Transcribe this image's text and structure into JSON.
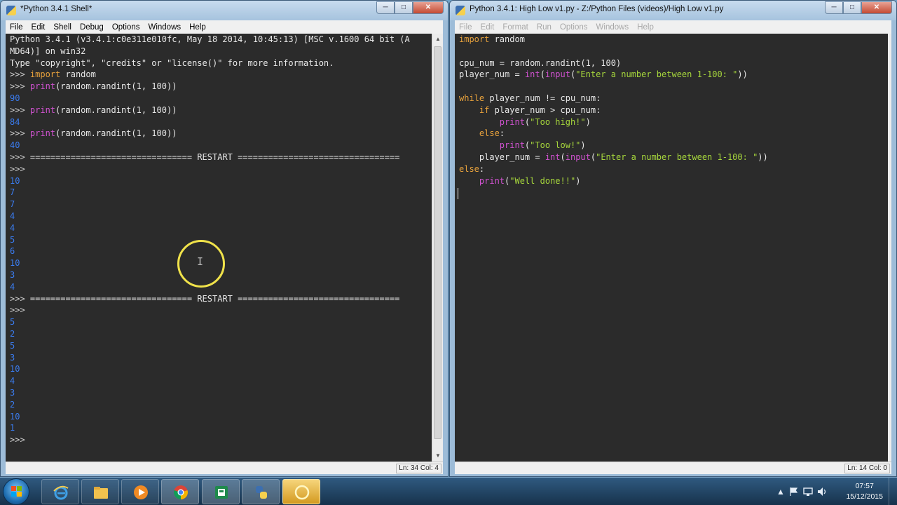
{
  "colors": {
    "code_background": "#2b2b2b",
    "code_text": "#e8e8e8",
    "keyword": "#e8a23c",
    "builtin": "#d052d0",
    "string": "#a6d63c",
    "shell_output": "#3a7cf0",
    "cursor_highlight": "#f0e24a"
  },
  "shell": {
    "title": "*Python 3.4.1 Shell*",
    "menu": [
      "File",
      "Edit",
      "Shell",
      "Debug",
      "Options",
      "Windows",
      "Help"
    ],
    "lines": [
      [
        {
          "t": "Python 3.4.1 (v3.4.1:c0e311e010fc, May 18 2014, 10:45:13) [MSC v.1600 64 bit (A",
          "c": "text"
        }
      ],
      [
        {
          "t": "MD64)] on win32",
          "c": "text"
        }
      ],
      [
        {
          "t": "Type \"copyright\", \"credits\" or \"license()\" for more information.",
          "c": "text"
        }
      ],
      [
        {
          "t": ">>> ",
          "c": "prompt"
        },
        {
          "t": "import",
          "c": "kw"
        },
        {
          "t": " random",
          "c": "text"
        }
      ],
      [
        {
          "t": ">>> ",
          "c": "prompt"
        },
        {
          "t": "print",
          "c": "builtin"
        },
        {
          "t": "(random.randint(1, 100))",
          "c": "text"
        }
      ],
      [
        {
          "t": "90",
          "c": "out"
        }
      ],
      [
        {
          "t": ">>> ",
          "c": "prompt"
        },
        {
          "t": "print",
          "c": "builtin"
        },
        {
          "t": "(random.randint(1, 100))",
          "c": "text"
        }
      ],
      [
        {
          "t": "84",
          "c": "out"
        }
      ],
      [
        {
          "t": ">>> ",
          "c": "prompt"
        },
        {
          "t": "print",
          "c": "builtin"
        },
        {
          "t": "(random.randint(1, 100))",
          "c": "text"
        }
      ],
      [
        {
          "t": "40",
          "c": "out"
        }
      ],
      [
        {
          "t": ">>> ",
          "c": "prompt"
        },
        {
          "t": "================================ RESTART ================================",
          "c": "text"
        }
      ],
      [
        {
          "t": ">>> ",
          "c": "prompt"
        }
      ],
      [
        {
          "t": "10",
          "c": "out"
        }
      ],
      [
        {
          "t": "7",
          "c": "out"
        }
      ],
      [
        {
          "t": "7",
          "c": "out"
        }
      ],
      [
        {
          "t": "4",
          "c": "out"
        }
      ],
      [
        {
          "t": "4",
          "c": "out"
        }
      ],
      [
        {
          "t": "5",
          "c": "out"
        }
      ],
      [
        {
          "t": "6",
          "c": "out"
        }
      ],
      [
        {
          "t": "10",
          "c": "out"
        }
      ],
      [
        {
          "t": "3",
          "c": "out"
        }
      ],
      [
        {
          "t": "4",
          "c": "out"
        }
      ],
      [
        {
          "t": ">>> ",
          "c": "prompt"
        },
        {
          "t": "================================ RESTART ================================",
          "c": "text"
        }
      ],
      [
        {
          "t": ">>> ",
          "c": "prompt"
        }
      ],
      [
        {
          "t": "5",
          "c": "out"
        }
      ],
      [
        {
          "t": "2",
          "c": "out"
        }
      ],
      [
        {
          "t": "5",
          "c": "out"
        }
      ],
      [
        {
          "t": "3",
          "c": "out"
        }
      ],
      [
        {
          "t": "10",
          "c": "out"
        }
      ],
      [
        {
          "t": "4",
          "c": "out"
        }
      ],
      [
        {
          "t": "3",
          "c": "out"
        }
      ],
      [
        {
          "t": "2",
          "c": "out"
        }
      ],
      [
        {
          "t": "10",
          "c": "out"
        }
      ],
      [
        {
          "t": "1",
          "c": "out"
        }
      ],
      [
        {
          "t": ">>> ",
          "c": "prompt"
        }
      ]
    ],
    "status": "Ln: 34 Col: 4"
  },
  "editor": {
    "title": "Python 3.4.1: High Low v1.py - Z:/Python Files (videos)/High Low v1.py",
    "menu": [
      "File",
      "Edit",
      "Format",
      "Run",
      "Options",
      "Windows",
      "Help"
    ],
    "lines": [
      [
        {
          "t": "import",
          "c": "kw"
        },
        {
          "t": " random",
          "c": "text"
        }
      ],
      [],
      [
        {
          "t": "cpu_num = random.randint(1, 100)",
          "c": "text"
        }
      ],
      [
        {
          "t": "player_num = ",
          "c": "text"
        },
        {
          "t": "int",
          "c": "builtin"
        },
        {
          "t": "(",
          "c": "text"
        },
        {
          "t": "input",
          "c": "builtin"
        },
        {
          "t": "(",
          "c": "text"
        },
        {
          "t": "\"Enter a number between 1-100: \"",
          "c": "str"
        },
        {
          "t": "))",
          "c": "text"
        }
      ],
      [],
      [
        {
          "t": "while",
          "c": "kw"
        },
        {
          "t": " player_num != cpu_num:",
          "c": "text"
        }
      ],
      [
        {
          "t": "    ",
          "c": "text"
        },
        {
          "t": "if",
          "c": "kw"
        },
        {
          "t": " player_num > cpu_num:",
          "c": "text"
        }
      ],
      [
        {
          "t": "        ",
          "c": "text"
        },
        {
          "t": "print",
          "c": "builtin"
        },
        {
          "t": "(",
          "c": "text"
        },
        {
          "t": "\"Too high!\"",
          "c": "str"
        },
        {
          "t": ")",
          "c": "text"
        }
      ],
      [
        {
          "t": "    ",
          "c": "text"
        },
        {
          "t": "else",
          "c": "kw"
        },
        {
          "t": ":",
          "c": "text"
        }
      ],
      [
        {
          "t": "        ",
          "c": "text"
        },
        {
          "t": "print",
          "c": "builtin"
        },
        {
          "t": "(",
          "c": "text"
        },
        {
          "t": "\"Too low!\"",
          "c": "str"
        },
        {
          "t": ")",
          "c": "text"
        }
      ],
      [
        {
          "t": "    player_num = ",
          "c": "text"
        },
        {
          "t": "int",
          "c": "builtin"
        },
        {
          "t": "(",
          "c": "text"
        },
        {
          "t": "input",
          "c": "builtin"
        },
        {
          "t": "(",
          "c": "text"
        },
        {
          "t": "\"Enter a number between 1-100: \"",
          "c": "str"
        },
        {
          "t": "))",
          "c": "text"
        }
      ],
      [
        {
          "t": "else",
          "c": "kw"
        },
        {
          "t": ":",
          "c": "text"
        }
      ],
      [
        {
          "t": "    ",
          "c": "text"
        },
        {
          "t": "print",
          "c": "builtin"
        },
        {
          "t": "(",
          "c": "text"
        },
        {
          "t": "\"Well done!!\"",
          "c": "str"
        },
        {
          "t": ")",
          "c": "text"
        }
      ]
    ],
    "status": "Ln: 14 Col: 0"
  },
  "window_controls": {
    "minimize": "─",
    "maximize": "□",
    "close": "✕"
  },
  "taskbar": {
    "buttons": [
      {
        "name": "internet-explorer-button",
        "icon": "internet-explorer-icon"
      },
      {
        "name": "file-explorer-button",
        "icon": "folder-icon"
      },
      {
        "name": "media-player-button",
        "icon": "media-player-icon"
      },
      {
        "name": "chrome-button",
        "icon": "chrome-icon"
      },
      {
        "name": "publisher-button",
        "icon": "publisher-icon"
      },
      {
        "name": "python-idle-button",
        "icon": "python-icon"
      },
      {
        "name": "cursor-highlighter-button",
        "icon": "highlighter-icon"
      }
    ],
    "tray": {
      "show_hidden": "▲",
      "time": "07:57",
      "date": "15/12/2015"
    }
  }
}
